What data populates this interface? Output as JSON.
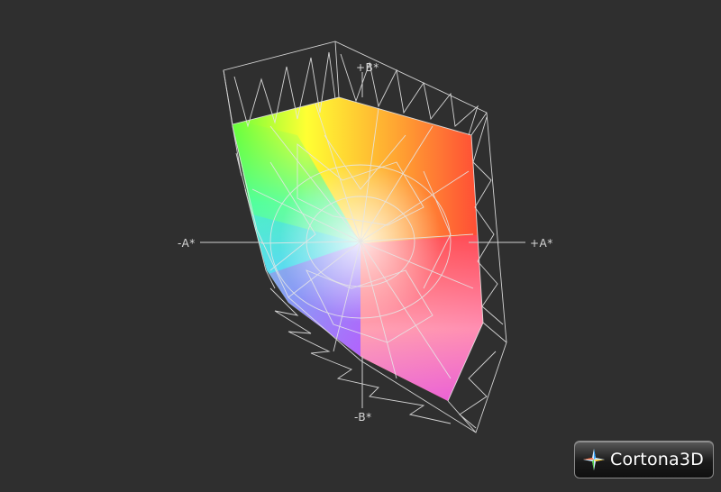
{
  "viewer": {
    "background": "#2f2f2f",
    "wire_color": "#e6e6e6"
  },
  "axes": {
    "neg_a": "-A*",
    "pos_a": "+A*",
    "pos_b": "+B*",
    "neg_b": "-B*"
  },
  "logo": {
    "text": "Cortona3D",
    "icon": "cortona-star-icon"
  }
}
